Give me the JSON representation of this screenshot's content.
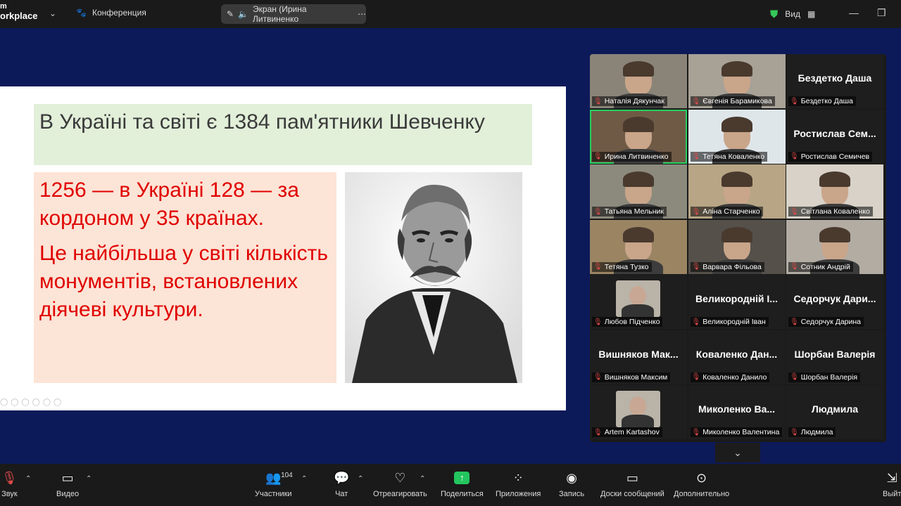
{
  "app": {
    "logo_line1": "m",
    "logo_line2": "orkplace"
  },
  "topbar": {
    "conference_label": "Конференция",
    "screen_share_label": "Экран (Ирина Литвиненко",
    "view_label": "Вид"
  },
  "slide": {
    "title": "В Україні та світі є 1384 пам'ятники Шевченку",
    "paragraph1": "1256 — в Україні 128 — за кордоном у 35 країнах.",
    "paragraph2": " Це найбільша у світі кількість монументів, встановлених діячеві культури."
  },
  "gallery": {
    "tiles": [
      {
        "caption": "Наталія Дякунчак",
        "big": ""
      },
      {
        "caption": "Євгенія Барамикова",
        "big": ""
      },
      {
        "caption": "Бездетко Даша",
        "big": "Бездетко Даша"
      },
      {
        "caption": "Ирина Литвиненко",
        "big": ""
      },
      {
        "caption": "Тетяна  Коваленко",
        "big": ""
      },
      {
        "caption": "Ростислав Семичев",
        "big": "Ростислав  Сем..."
      },
      {
        "caption": "Татьяна Мельник",
        "big": ""
      },
      {
        "caption": "Аліна Старченко",
        "big": ""
      },
      {
        "caption": "Світлана Коваленко",
        "big": ""
      },
      {
        "caption": "Тетяна Тузко",
        "big": ""
      },
      {
        "caption": "Варвара Фільова",
        "big": ""
      },
      {
        "caption": "Сотник Андрій",
        "big": ""
      },
      {
        "caption": "Любов Підченко",
        "big": ""
      },
      {
        "caption": "Великородній Іван",
        "big": "Великородній І..."
      },
      {
        "caption": "Седорчук Дарина",
        "big": "Седорчук  Дари..."
      },
      {
        "caption": "Вишняков Максим",
        "big": "Вишняков  Мак..."
      },
      {
        "caption": "Коваленко Данило",
        "big": "Коваленко  Дан..."
      },
      {
        "caption": "Шорбан Валерія",
        "big": "Шорбан Валерія"
      },
      {
        "caption": "Artem Kartashov",
        "big": ""
      },
      {
        "caption": "Миколенко Валентина",
        "big": "Миколенко  Ва..."
      },
      {
        "caption": "Людмила",
        "big": "Людмила"
      }
    ]
  },
  "toolbar": {
    "sound": "Звук",
    "video": "Видео",
    "participants": "Участники",
    "participants_count": "104",
    "chat": "Чат",
    "react": "Отреагировать",
    "share": "Поделиться",
    "apps": "Приложения",
    "record": "Запись",
    "whiteboard": "Доски сообщений",
    "more": "Дополнительно",
    "leave": "Выйт"
  },
  "colors": {
    "background": "#0d1a59",
    "active_speaker": "#23d160",
    "share_green": "#23c55e",
    "slide_red": "#e00000"
  }
}
